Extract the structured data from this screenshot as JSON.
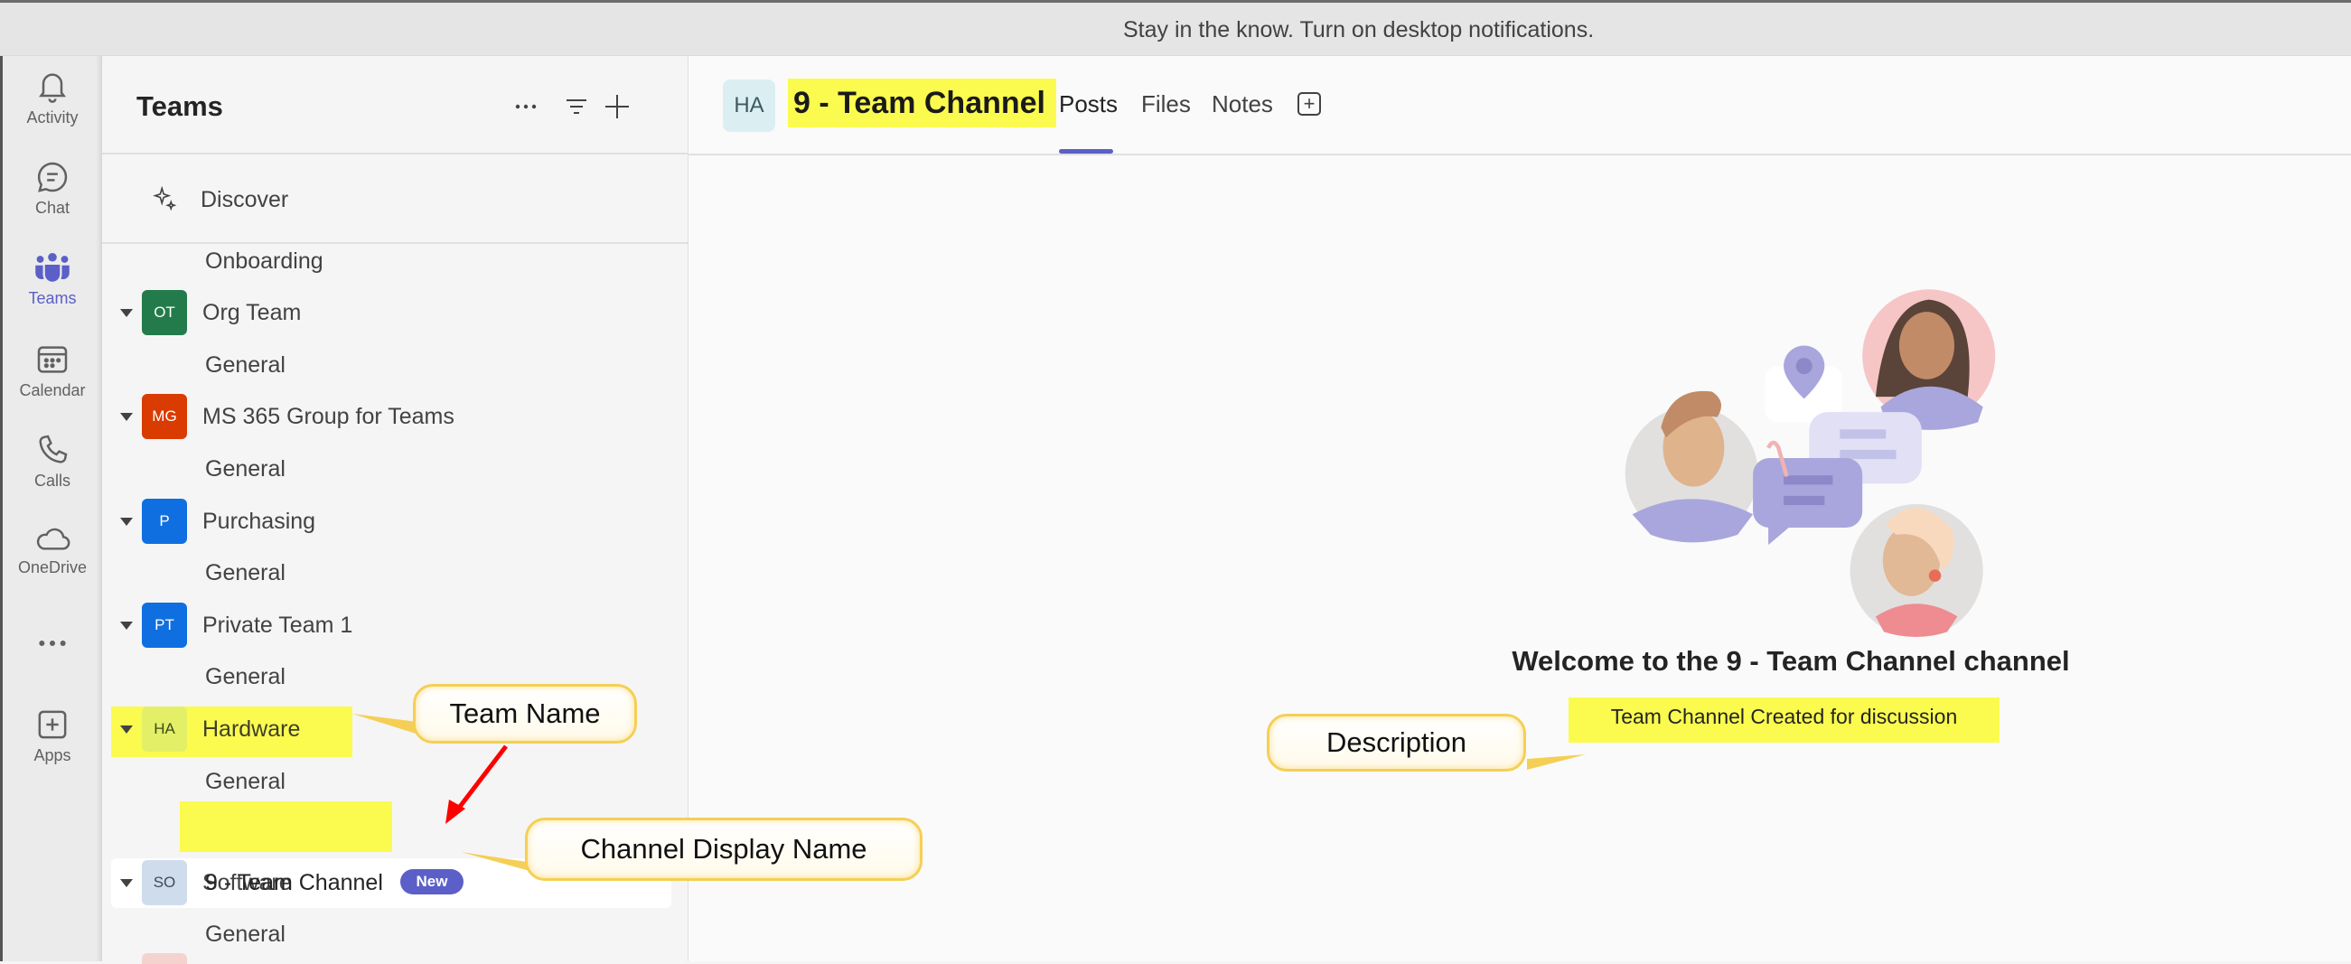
{
  "banner": {
    "text": "Stay in the know. Turn on desktop notifications."
  },
  "rail": {
    "items": [
      {
        "label": "Activity",
        "icon": "bell-icon"
      },
      {
        "label": "Chat",
        "icon": "chat-icon"
      },
      {
        "label": "Teams",
        "icon": "teams-icon",
        "active": true
      },
      {
        "label": "Calendar",
        "icon": "calendar-icon"
      },
      {
        "label": "Calls",
        "icon": "phone-icon"
      },
      {
        "label": "OneDrive",
        "icon": "cloud-icon"
      },
      {
        "label": "",
        "icon": "more-icon"
      },
      {
        "label": "Apps",
        "icon": "apps-icon"
      }
    ]
  },
  "teams_panel": {
    "title": "Teams",
    "discover_label": "Discover",
    "list": [
      {
        "type": "channel",
        "name": "Onboarding"
      },
      {
        "type": "team",
        "initials": "OT",
        "name": "Org Team",
        "color": "#237b4b"
      },
      {
        "type": "channel",
        "name": "General"
      },
      {
        "type": "team",
        "initials": "MG",
        "name": "MS 365 Group for Teams",
        "color": "#da3b01"
      },
      {
        "type": "channel",
        "name": "General"
      },
      {
        "type": "team",
        "initials": "P",
        "name": "Purchasing",
        "color": "#0f6cbd"
      },
      {
        "type": "channel",
        "name": "General"
      },
      {
        "type": "team",
        "initials": "PT",
        "name": "Private Team 1",
        "color": "#0f6cbd"
      },
      {
        "type": "channel",
        "name": "General"
      },
      {
        "type": "team",
        "initials": "HA",
        "name": "Hardware",
        "color": "#e3ef67"
      },
      {
        "type": "channel",
        "name": "General"
      },
      {
        "type": "channel",
        "name": "9 - Team Channel",
        "badge": "New",
        "selected": true
      },
      {
        "type": "team",
        "initials": "SO",
        "name": "Software",
        "color": "#cfdcec"
      },
      {
        "type": "channel",
        "name": "General"
      }
    ]
  },
  "channel": {
    "team_initials": "HA",
    "title": "9 - Team Channel",
    "tabs": [
      {
        "label": "Posts",
        "active": true
      },
      {
        "label": "Files"
      },
      {
        "label": "Notes"
      }
    ],
    "welcome": "Welcome to the 9 - Team Channel channel",
    "description": "Team Channel Created for discussion"
  },
  "annotations": {
    "team_name": "Team Name",
    "channel_display_name": "Channel Display Name",
    "description": "Description"
  },
  "colors": {
    "accent": "#5b5fc7",
    "highlight": "#fbfb4f",
    "callout_border": "#f5cf55",
    "arrow": "#ff0000"
  }
}
